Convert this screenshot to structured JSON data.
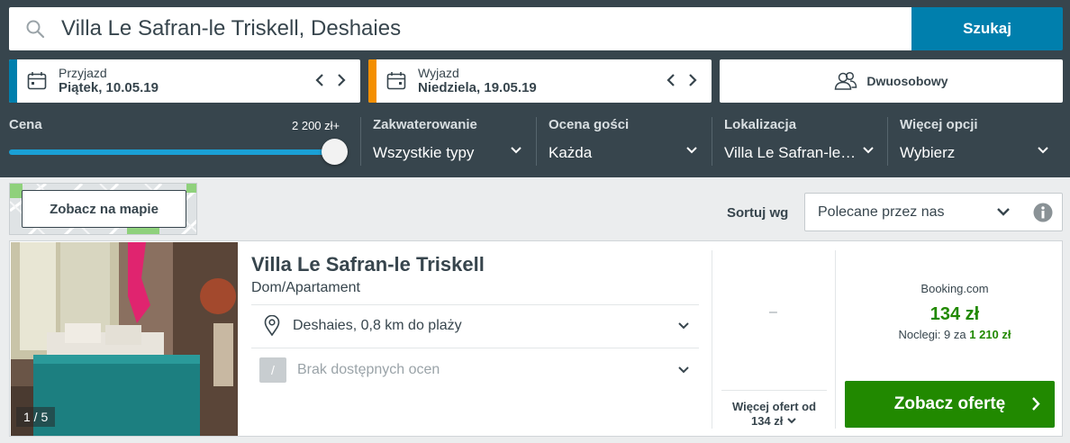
{
  "search": {
    "value": "Villa Le Safran-le Triskell, Deshaies",
    "button_label": "Szukaj"
  },
  "checkin": {
    "label": "Przyjazd",
    "value": "Piątek, 10.05.19",
    "accent": "#007fad"
  },
  "checkout": {
    "label": "Wyjazd",
    "value": "Niedziela, 19.05.19",
    "accent": "#f48f00"
  },
  "room": {
    "label": "Dwuosobowy"
  },
  "filters": {
    "price": {
      "title": "Cena",
      "max_label": "2 200 zł+",
      "slider_level": 1.0
    },
    "accommodation": {
      "title": "Zakwaterowanie",
      "value": "Wszystkie typy"
    },
    "rating": {
      "title": "Ocena gości",
      "value": "Każda"
    },
    "location": {
      "title": "Lokalizacja",
      "value": "Villa Le Safran-le…"
    },
    "more": {
      "title": "Więcej opcji",
      "value": "Wybierz"
    }
  },
  "map_button": "Zobacz na mapie",
  "sort": {
    "label": "Sortuj wg",
    "value": "Polecane przez nas"
  },
  "hotel": {
    "photo_counter": "1 / 5",
    "name": "Villa Le Safran-le Triskell",
    "type": "Dom/Apartament",
    "location": "Deshaies, 0,8 km do plaży",
    "rating_badge": "/",
    "rating_text": "Brak dostępnych ocen",
    "alt_price": "–",
    "more_offers_line1": "Więcej ofert od",
    "more_offers_line2": "134 zł",
    "provider": "Booking.com",
    "price": "134 zł",
    "nights_prefix": "Noclegi: 9 za",
    "nights_total": "1 210 zł",
    "deal_button": "Zobacz ofertę"
  },
  "colors": {
    "header_bg": "#37454d",
    "search_button": "#007fad",
    "price_green": "#218900",
    "slider": "#1aa0d6"
  }
}
